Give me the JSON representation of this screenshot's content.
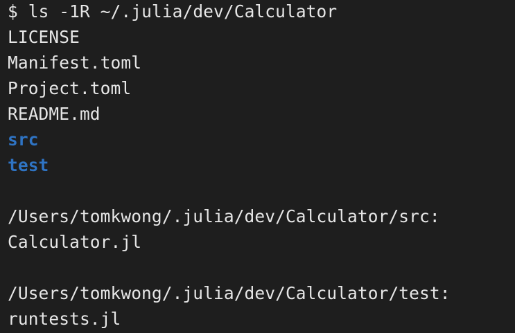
{
  "terminal": {
    "prompt_symbol": "$",
    "command": "ls -1R ~/.julia/dev/Calculator",
    "root_listing": [
      {
        "name": "LICENSE",
        "type": "file"
      },
      {
        "name": "Manifest.toml",
        "type": "file"
      },
      {
        "name": "Project.toml",
        "type": "file"
      },
      {
        "name": "README.md",
        "type": "file"
      },
      {
        "name": "src",
        "type": "directory"
      },
      {
        "name": "test",
        "type": "directory"
      }
    ],
    "sections": [
      {
        "header": "/Users/tomkwong/.julia/dev/Calculator/src:",
        "files": [
          "Calculator.jl"
        ]
      },
      {
        "header": "/Users/tomkwong/.julia/dev/Calculator/test:",
        "files": [
          "runtests.jl"
        ]
      }
    ]
  },
  "colors": {
    "background": "#1e1e1e",
    "text": "#e6e6e6",
    "directory": "#2f74c4"
  }
}
